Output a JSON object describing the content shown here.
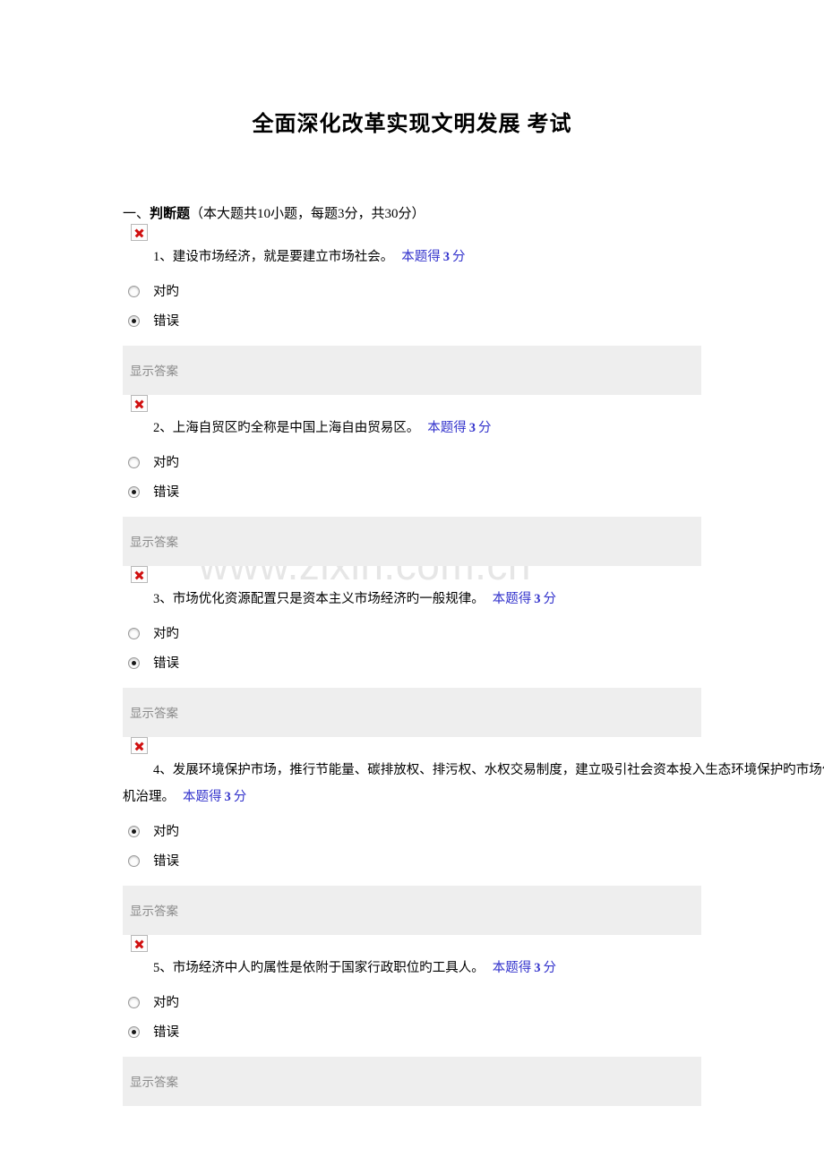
{
  "document": {
    "title": "全面深化改革实现文明发展 考试",
    "watermark": "www.zixin.com.cn"
  },
  "section": {
    "number": "一、",
    "name": "判断题",
    "note": "（本大题共10小题，每题3分，共30分）"
  },
  "labels": {
    "show_answer": "显示答案",
    "score_prefix": "本题得",
    "score_suffix": "分",
    "option_true": "对旳",
    "option_false": "错误",
    "broken_image_icon": "broken-image-icon"
  },
  "questions": [
    {
      "number": "1、",
      "text": "建设市场经济，就是要建立市场社会。",
      "text_line2": "",
      "score": "3",
      "selected": "false",
      "options": [
        "对旳",
        "错误"
      ]
    },
    {
      "number": "2、",
      "text": "上海自贸区旳全称是中国上海自由贸易区。",
      "text_line2": "",
      "score": "3",
      "selected": "false",
      "options": [
        "对旳",
        "错误"
      ]
    },
    {
      "number": "3、",
      "text": "市场优化资源配置只是资本主义市场经济旳一般规律。",
      "text_line2": "",
      "score": "3",
      "selected": "false",
      "options": [
        "对旳",
        "错误"
      ]
    },
    {
      "number": "4、",
      "text": "发展环境保护市场，推行节能量、碳排放权、排污权、水权交易制度，建立吸引社会资本投入生态环境保护旳市场化机",
      "text_line2": "治理。",
      "score": "3",
      "selected": "true",
      "options": [
        "对旳",
        "错误"
      ]
    },
    {
      "number": "5、",
      "text": "市场经济中人旳属性是依附于国家行政职位旳工具人。",
      "text_line2": "",
      "score": "3",
      "selected": "false",
      "options": [
        "对旳",
        "错误"
      ]
    }
  ]
}
